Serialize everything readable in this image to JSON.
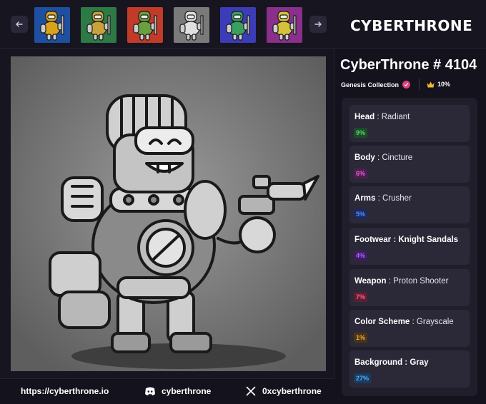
{
  "brand": {
    "logo_text": "CYBERTHRONE"
  },
  "nft": {
    "title": "CyberThrone # 4104",
    "collection": "Genesis Collection",
    "rarity": "10%"
  },
  "gallery": {
    "thumbnails": [
      {
        "name": "thumb-1",
        "bg": "#1e4fa0",
        "body": "#d9a21b"
      },
      {
        "name": "thumb-2",
        "bg": "#2e7a45",
        "body": "#c8a23a"
      },
      {
        "name": "thumb-3",
        "bg": "#c23a28",
        "body": "#6aa040"
      },
      {
        "name": "thumb-4",
        "bg": "#7a7a7a",
        "body": "#e0e0e0"
      },
      {
        "name": "thumb-5",
        "bg": "#3d3cb8",
        "body": "#3aa060"
      },
      {
        "name": "thumb-6",
        "bg": "#8a2f8a",
        "body": "#d6c23a"
      }
    ]
  },
  "traits": [
    {
      "name": "Head",
      "value": "Radiant",
      "pct": "9%",
      "pct_bg": "#1f4a2a",
      "pct_color": "#4fd46e",
      "value_bold": false
    },
    {
      "name": "Body",
      "value": "Cincture",
      "pct": "6%",
      "pct_bg": "#4a1f4e",
      "pct_color": "#e85ed6",
      "value_bold": false
    },
    {
      "name": "Arms",
      "value": "Crusher",
      "pct": "5%",
      "pct_bg": "#1b2a5e",
      "pct_color": "#5a8cff",
      "value_bold": false
    },
    {
      "name": "Footwear",
      "value": "Knight Sandals",
      "pct": "4%",
      "pct_bg": "#3a1f5e",
      "pct_color": "#b45cff",
      "value_bold": true
    },
    {
      "name": "Weapon",
      "value": "Proton Shooter",
      "pct": "7%",
      "pct_bg": "#5a1f34",
      "pct_color": "#ff5c8a",
      "value_bold": false
    },
    {
      "name": "Color Scheme",
      "value": "Grayscale",
      "pct": "1%",
      "pct_bg": "#4a3418",
      "pct_color": "#f0a83c",
      "value_bold": false
    },
    {
      "name": "Background",
      "value": "Gray",
      "pct": "27%",
      "pct_bg": "#1b3a5e",
      "pct_color": "#4cb4ff",
      "value_bold": true
    }
  ],
  "footer": {
    "website": "https://cyberthrone.io",
    "discord": "cyberthrone",
    "x_handle": "0xcyberthrone"
  },
  "colors": {
    "accent_pink": "#e0407a",
    "crown_gold": "#f2b632"
  }
}
